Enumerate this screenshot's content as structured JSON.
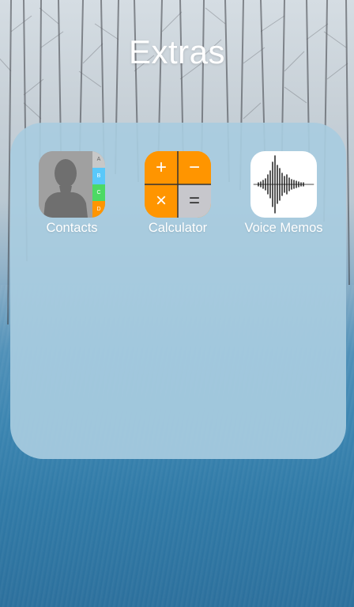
{
  "folder": {
    "title": "Extras"
  },
  "apps": [
    {
      "label": "Contacts",
      "icon": "contacts-icon",
      "tabs": [
        "A",
        "B",
        "C",
        "D"
      ],
      "tab_colors": [
        "#c8c8c8",
        "#5ac8fa",
        "#4cd964",
        "#ff9500"
      ]
    },
    {
      "label": "Calculator",
      "icon": "calculator-icon",
      "keys": [
        "+",
        "−",
        "×",
        "="
      ],
      "key_colors": [
        "#ff9500",
        "#ff9500",
        "#ff9500",
        "#c7c7cc"
      ]
    },
    {
      "label": "Voice Memos",
      "icon": "voice-memos-icon"
    }
  ],
  "colors": {
    "folder_bg": "#a8cce0",
    "label_text": "#ffffff"
  }
}
